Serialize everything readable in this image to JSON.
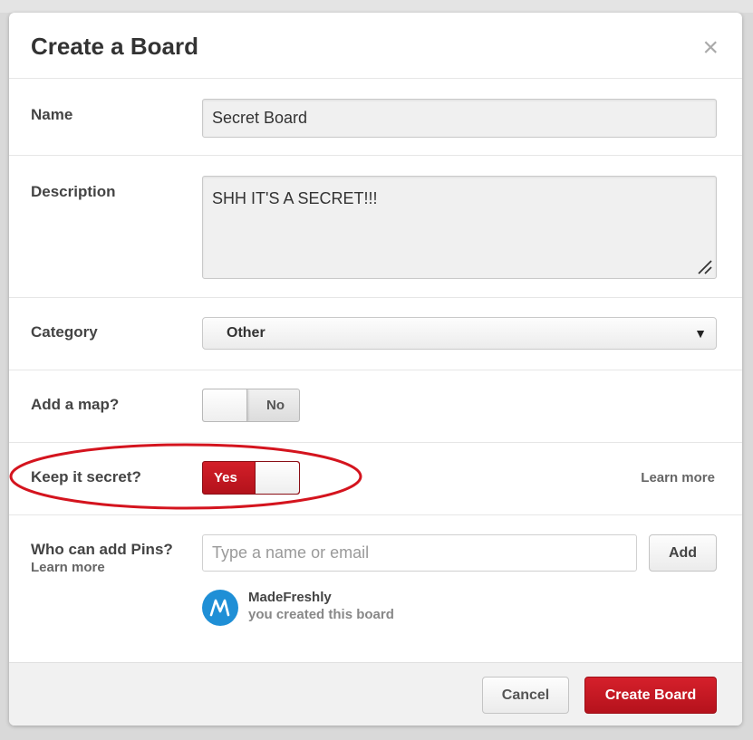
{
  "dialog": {
    "title": "Create a Board",
    "close_glyph": "×"
  },
  "form": {
    "name": {
      "label": "Name",
      "value": "Secret Board"
    },
    "description": {
      "label": "Description",
      "value": "SHH IT'S A SECRET!!!"
    },
    "category": {
      "label": "Category",
      "selected": "Other",
      "arrow": "▼"
    },
    "map": {
      "label": "Add a map?",
      "toggle_text": "No",
      "enabled": false
    },
    "secret": {
      "label": "Keep it secret?",
      "toggle_text": "Yes",
      "enabled": true,
      "learn_more": "Learn more"
    },
    "pins": {
      "label": "Who can add Pins?",
      "learn_more": "Learn more",
      "placeholder": "Type a name or email",
      "add_label": "Add",
      "collaborator": {
        "name": "MadeFreshly",
        "note": "you created this board",
        "avatar_letter": "M"
      }
    }
  },
  "footer": {
    "cancel_label": "Cancel",
    "create_label": "Create Board"
  },
  "colors": {
    "brand_red": "#c8161f",
    "annotation_red": "#d4141e",
    "avatar_blue": "#1f8fd6"
  },
  "icons": {
    "close": "close-icon",
    "dropdown": "chevron-down-icon",
    "resize": "resize-handle-icon"
  }
}
